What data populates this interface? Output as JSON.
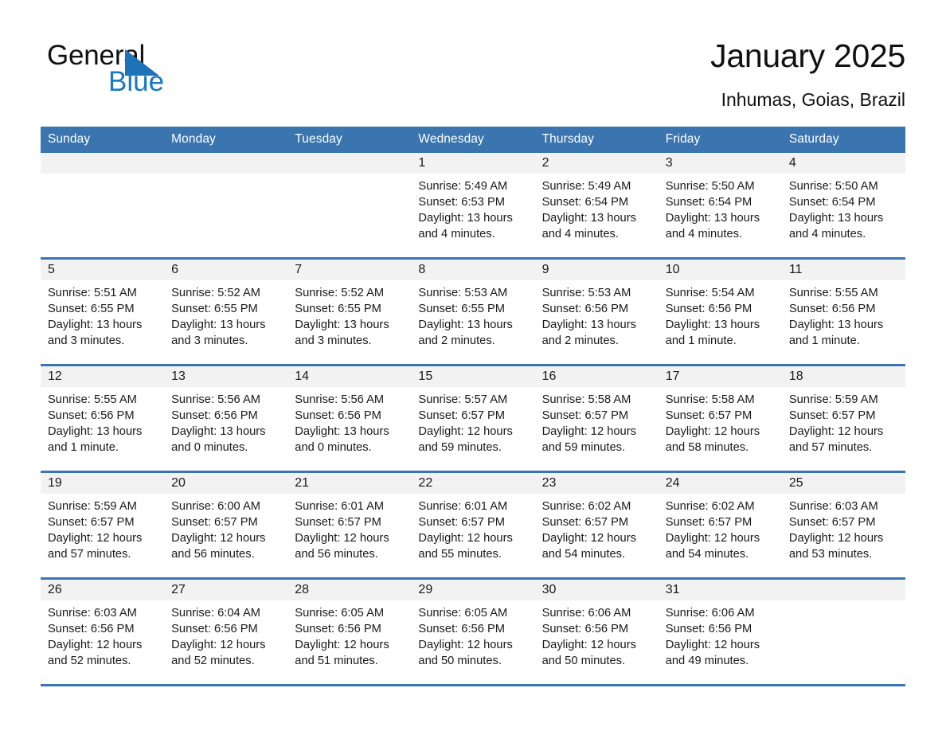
{
  "brand": {
    "logo_text_1": "General",
    "logo_text_2": "Blue",
    "logo_triangle_color": "#1d72b8",
    "accent_color": "#3a75b0"
  },
  "header": {
    "title": "January 2025",
    "subtitle": "Inhumas, Goias, Brazil"
  },
  "weekday_headers": [
    "Sunday",
    "Monday",
    "Tuesday",
    "Wednesday",
    "Thursday",
    "Friday",
    "Saturday"
  ],
  "weeks": [
    [
      {
        "day": "",
        "sunrise": "",
        "sunset": "",
        "daylight": ""
      },
      {
        "day": "",
        "sunrise": "",
        "sunset": "",
        "daylight": ""
      },
      {
        "day": "",
        "sunrise": "",
        "sunset": "",
        "daylight": ""
      },
      {
        "day": "1",
        "sunrise": "Sunrise: 5:49 AM",
        "sunset": "Sunset: 6:53 PM",
        "daylight": "Daylight: 13 hours and 4 minutes."
      },
      {
        "day": "2",
        "sunrise": "Sunrise: 5:49 AM",
        "sunset": "Sunset: 6:54 PM",
        "daylight": "Daylight: 13 hours and 4 minutes."
      },
      {
        "day": "3",
        "sunrise": "Sunrise: 5:50 AM",
        "sunset": "Sunset: 6:54 PM",
        "daylight": "Daylight: 13 hours and 4 minutes."
      },
      {
        "day": "4",
        "sunrise": "Sunrise: 5:50 AM",
        "sunset": "Sunset: 6:54 PM",
        "daylight": "Daylight: 13 hours and 4 minutes."
      }
    ],
    [
      {
        "day": "5",
        "sunrise": "Sunrise: 5:51 AM",
        "sunset": "Sunset: 6:55 PM",
        "daylight": "Daylight: 13 hours and 3 minutes."
      },
      {
        "day": "6",
        "sunrise": "Sunrise: 5:52 AM",
        "sunset": "Sunset: 6:55 PM",
        "daylight": "Daylight: 13 hours and 3 minutes."
      },
      {
        "day": "7",
        "sunrise": "Sunrise: 5:52 AM",
        "sunset": "Sunset: 6:55 PM",
        "daylight": "Daylight: 13 hours and 3 minutes."
      },
      {
        "day": "8",
        "sunrise": "Sunrise: 5:53 AM",
        "sunset": "Sunset: 6:55 PM",
        "daylight": "Daylight: 13 hours and 2 minutes."
      },
      {
        "day": "9",
        "sunrise": "Sunrise: 5:53 AM",
        "sunset": "Sunset: 6:56 PM",
        "daylight": "Daylight: 13 hours and 2 minutes."
      },
      {
        "day": "10",
        "sunrise": "Sunrise: 5:54 AM",
        "sunset": "Sunset: 6:56 PM",
        "daylight": "Daylight: 13 hours and 1 minute."
      },
      {
        "day": "11",
        "sunrise": "Sunrise: 5:55 AM",
        "sunset": "Sunset: 6:56 PM",
        "daylight": "Daylight: 13 hours and 1 minute."
      }
    ],
    [
      {
        "day": "12",
        "sunrise": "Sunrise: 5:55 AM",
        "sunset": "Sunset: 6:56 PM",
        "daylight": "Daylight: 13 hours and 1 minute."
      },
      {
        "day": "13",
        "sunrise": "Sunrise: 5:56 AM",
        "sunset": "Sunset: 6:56 PM",
        "daylight": "Daylight: 13 hours and 0 minutes."
      },
      {
        "day": "14",
        "sunrise": "Sunrise: 5:56 AM",
        "sunset": "Sunset: 6:56 PM",
        "daylight": "Daylight: 13 hours and 0 minutes."
      },
      {
        "day": "15",
        "sunrise": "Sunrise: 5:57 AM",
        "sunset": "Sunset: 6:57 PM",
        "daylight": "Daylight: 12 hours and 59 minutes."
      },
      {
        "day": "16",
        "sunrise": "Sunrise: 5:58 AM",
        "sunset": "Sunset: 6:57 PM",
        "daylight": "Daylight: 12 hours and 59 minutes."
      },
      {
        "day": "17",
        "sunrise": "Sunrise: 5:58 AM",
        "sunset": "Sunset: 6:57 PM",
        "daylight": "Daylight: 12 hours and 58 minutes."
      },
      {
        "day": "18",
        "sunrise": "Sunrise: 5:59 AM",
        "sunset": "Sunset: 6:57 PM",
        "daylight": "Daylight: 12 hours and 57 minutes."
      }
    ],
    [
      {
        "day": "19",
        "sunrise": "Sunrise: 5:59 AM",
        "sunset": "Sunset: 6:57 PM",
        "daylight": "Daylight: 12 hours and 57 minutes."
      },
      {
        "day": "20",
        "sunrise": "Sunrise: 6:00 AM",
        "sunset": "Sunset: 6:57 PM",
        "daylight": "Daylight: 12 hours and 56 minutes."
      },
      {
        "day": "21",
        "sunrise": "Sunrise: 6:01 AM",
        "sunset": "Sunset: 6:57 PM",
        "daylight": "Daylight: 12 hours and 56 minutes."
      },
      {
        "day": "22",
        "sunrise": "Sunrise: 6:01 AM",
        "sunset": "Sunset: 6:57 PM",
        "daylight": "Daylight: 12 hours and 55 minutes."
      },
      {
        "day": "23",
        "sunrise": "Sunrise: 6:02 AM",
        "sunset": "Sunset: 6:57 PM",
        "daylight": "Daylight: 12 hours and 54 minutes."
      },
      {
        "day": "24",
        "sunrise": "Sunrise: 6:02 AM",
        "sunset": "Sunset: 6:57 PM",
        "daylight": "Daylight: 12 hours and 54 minutes."
      },
      {
        "day": "25",
        "sunrise": "Sunrise: 6:03 AM",
        "sunset": "Sunset: 6:57 PM",
        "daylight": "Daylight: 12 hours and 53 minutes."
      }
    ],
    [
      {
        "day": "26",
        "sunrise": "Sunrise: 6:03 AM",
        "sunset": "Sunset: 6:56 PM",
        "daylight": "Daylight: 12 hours and 52 minutes."
      },
      {
        "day": "27",
        "sunrise": "Sunrise: 6:04 AM",
        "sunset": "Sunset: 6:56 PM",
        "daylight": "Daylight: 12 hours and 52 minutes."
      },
      {
        "day": "28",
        "sunrise": "Sunrise: 6:05 AM",
        "sunset": "Sunset: 6:56 PM",
        "daylight": "Daylight: 12 hours and 51 minutes."
      },
      {
        "day": "29",
        "sunrise": "Sunrise: 6:05 AM",
        "sunset": "Sunset: 6:56 PM",
        "daylight": "Daylight: 12 hours and 50 minutes."
      },
      {
        "day": "30",
        "sunrise": "Sunrise: 6:06 AM",
        "sunset": "Sunset: 6:56 PM",
        "daylight": "Daylight: 12 hours and 50 minutes."
      },
      {
        "day": "31",
        "sunrise": "Sunrise: 6:06 AM",
        "sunset": "Sunset: 6:56 PM",
        "daylight": "Daylight: 12 hours and 49 minutes."
      },
      {
        "day": "",
        "sunrise": "",
        "sunset": "",
        "daylight": ""
      }
    ]
  ]
}
